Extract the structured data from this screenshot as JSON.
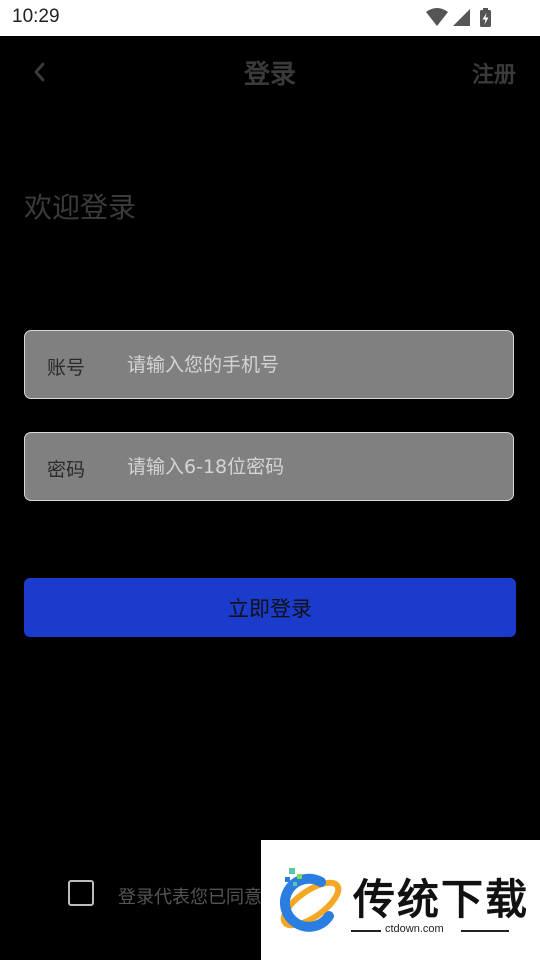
{
  "status_bar": {
    "time": "10:29"
  },
  "header": {
    "title": "登录",
    "register_label": "注册"
  },
  "welcome_text": "欢迎登录",
  "form": {
    "account": {
      "label": "账号",
      "value": "",
      "placeholder": "请输入您的手机号"
    },
    "password": {
      "label": "密码",
      "value": "",
      "placeholder": "请输入6-18位密码"
    },
    "submit_label": "立即登录"
  },
  "agreement": {
    "checked": false,
    "text": "登录代表您已同意"
  },
  "watermark": {
    "title": "传统下载",
    "url": "ctdown.com"
  },
  "colors": {
    "background": "#000000",
    "button": "#1a3bcc",
    "field": "#808080"
  },
  "icons": {
    "back": "chevron-left-icon",
    "wifi": "wifi-icon",
    "signal": "signal-icon",
    "battery": "battery-charging-icon"
  }
}
